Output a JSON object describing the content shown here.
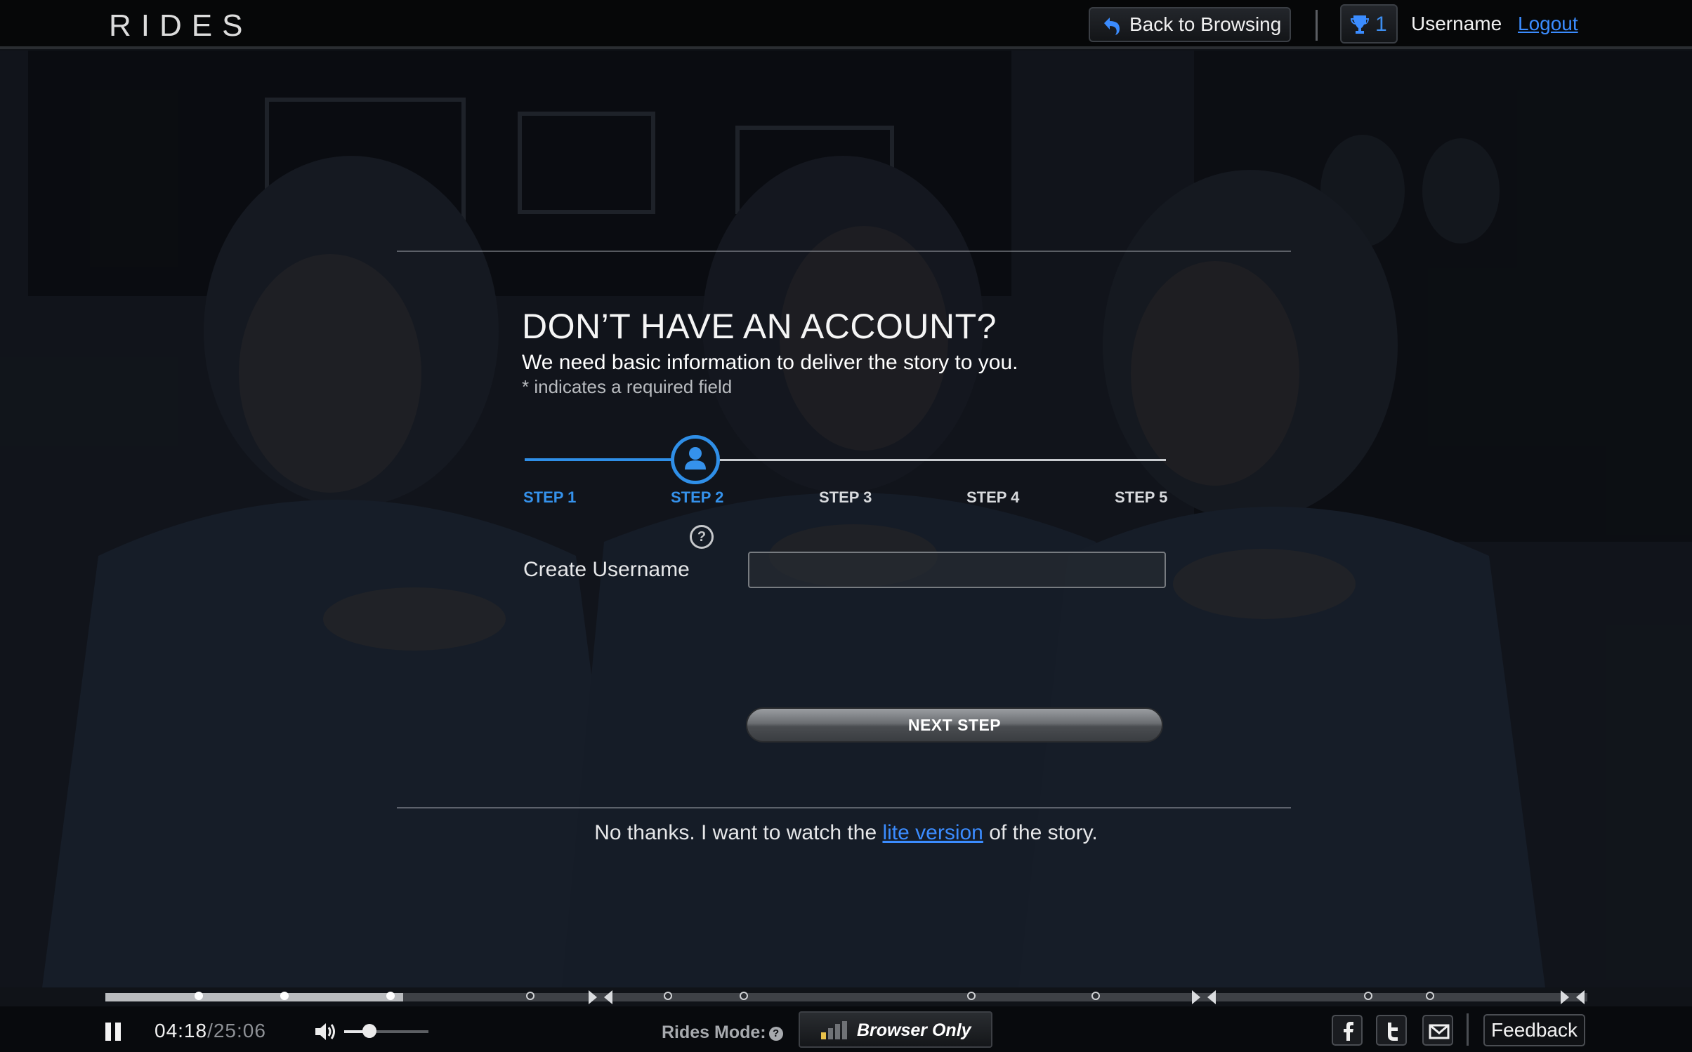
{
  "header": {
    "logo": "RIDES",
    "back_button": "Back to Browsing",
    "trophy_count": "1",
    "username": "Username",
    "logout": "Logout"
  },
  "form": {
    "heading": "DON’T HAVE AN ACCOUNT?",
    "subheading": "We need basic information to deliver the story to you.",
    "required_note": "* indicates a required field",
    "steps": [
      {
        "label": "STEP 1",
        "state": "done"
      },
      {
        "label": "STEP 2",
        "state": "current"
      },
      {
        "label": "STEP 3",
        "state": "todo"
      },
      {
        "label": "STEP 4",
        "state": "todo"
      },
      {
        "label": "STEP 5",
        "state": "todo"
      }
    ],
    "help_icon": "?",
    "username_label": "Create Username",
    "username_value": "",
    "next_button": "NEXT STEP",
    "lite_prefix": "No thanks. I want to watch the ",
    "lite_link": "lite version",
    "lite_suffix": " of the story."
  },
  "player": {
    "time_current": "04:18",
    "time_total": "/25:06",
    "progress_fraction": 0.201,
    "volume_fraction": 0.3,
    "rides_mode_label": "Rides Mode:",
    "rides_mode_help": "?",
    "mode_button": "Browser Only",
    "feedback": "Feedback",
    "icons": [
      "pause-icon",
      "volume-icon",
      "signal-bars-icon",
      "facebook-icon",
      "twitter-icon",
      "email-icon"
    ]
  },
  "colors": {
    "accent_blue": "#2f8fe8",
    "link_blue": "#3b8cff"
  }
}
